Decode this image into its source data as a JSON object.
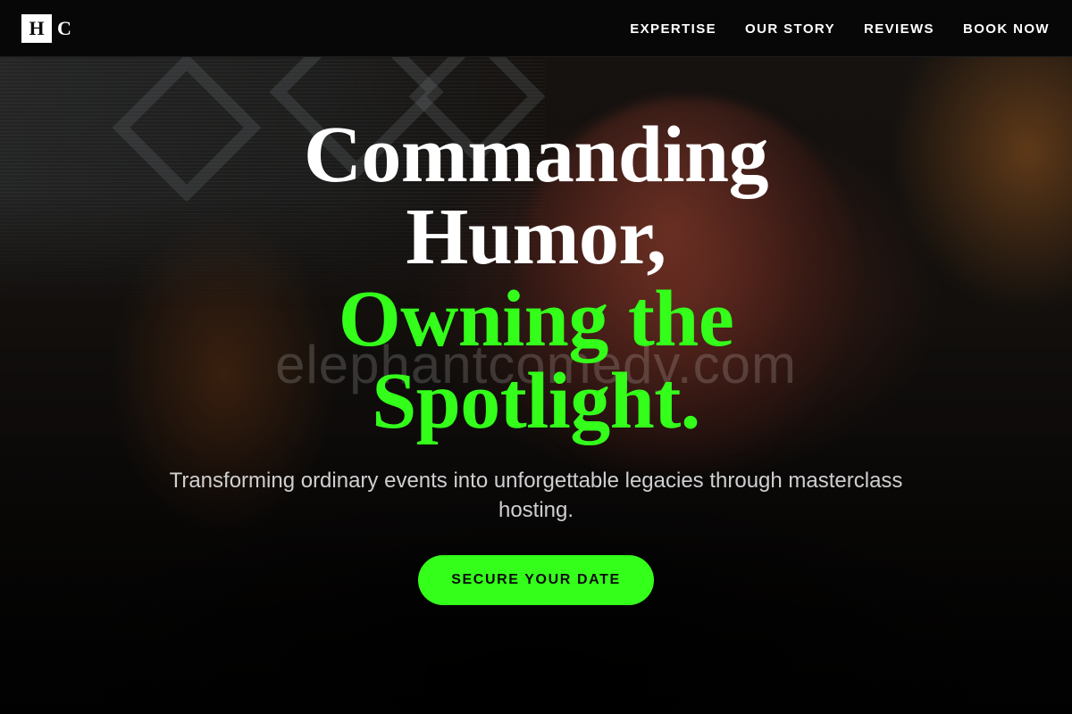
{
  "colors": {
    "accent": "#33ff1a",
    "nav_background": "#070707",
    "headline_white": "#ffffff",
    "subtitle": "#cfcfcf"
  },
  "nav": {
    "logo": {
      "box_letter": "H",
      "second_letter": "C"
    },
    "links": [
      {
        "label": "EXPERTISE"
      },
      {
        "label": "OUR STORY"
      },
      {
        "label": "REVIEWS"
      },
      {
        "label": "BOOK NOW"
      }
    ]
  },
  "hero": {
    "headline_lines": [
      "Commanding",
      "Humor,",
      "Owning the",
      "Spotlight."
    ],
    "subtitle": "Transforming ordinary events into unforgettable legacies through masterclass hosting.",
    "cta_label": "SECURE YOUR DATE",
    "watermark": "elephantcomedy.com"
  }
}
